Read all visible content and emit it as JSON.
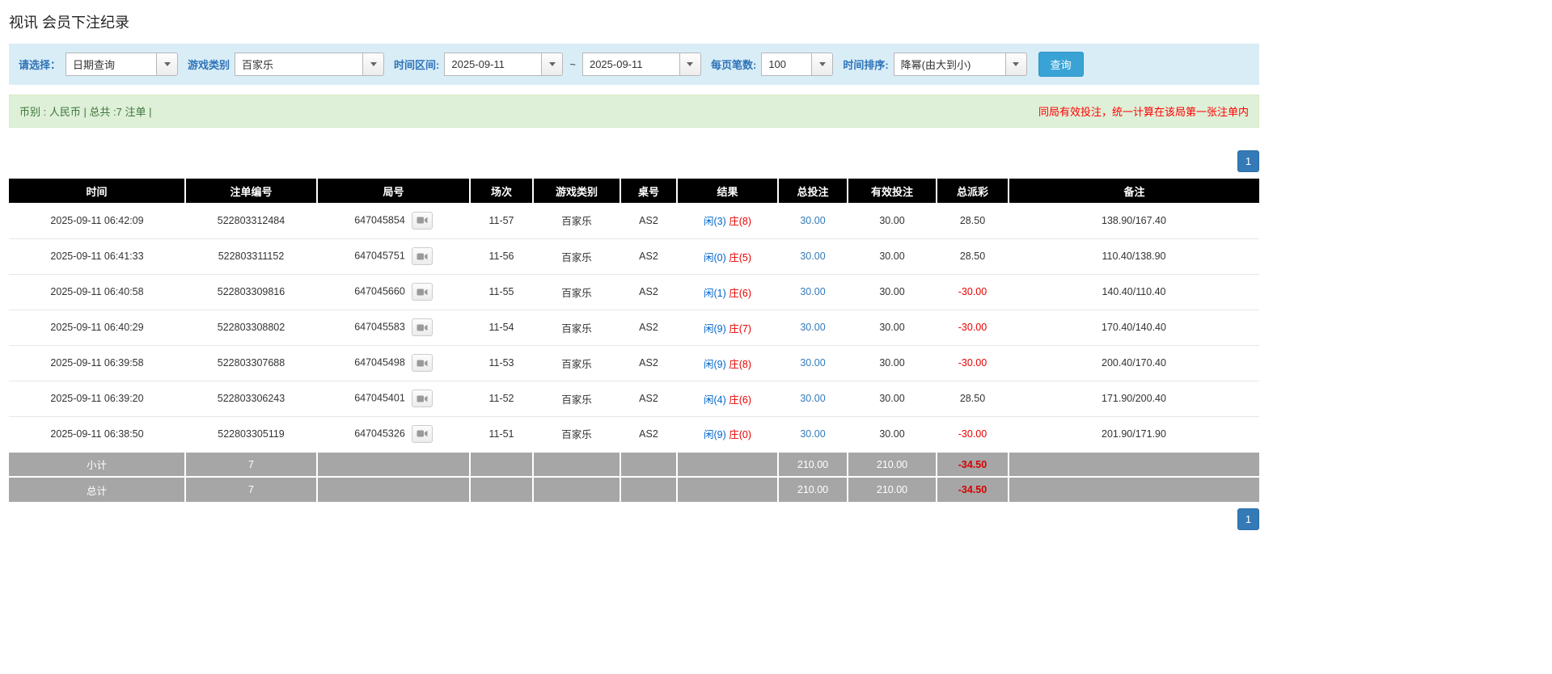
{
  "page": {
    "title": "视讯 会员下注纪录"
  },
  "filters": {
    "select_label": "请选择：",
    "select_value": "日期查询",
    "game_type_label": "游戏类别",
    "game_type_value": "百家乐",
    "time_range_label": "时间区间:",
    "time_from": "2025-09-11",
    "time_separator": "~",
    "time_to": "2025-09-11",
    "page_size_label": "每页笔数:",
    "page_size_value": "100",
    "sort_label": "时间排序:",
    "sort_value": "降幂(由大到小)",
    "search_button": "查询"
  },
  "summary": {
    "left": "币别 : 人民币 | 总共 :7 注单 |",
    "right": "同局有效投注，统一计算在该局第一张注单内"
  },
  "pagination": {
    "page": "1"
  },
  "table": {
    "headers": [
      "时间",
      "注单编号",
      "局号",
      "场次",
      "游戏类别",
      "桌号",
      "结果",
      "总投注",
      "有效投注",
      "总派彩",
      "备注"
    ],
    "rows": [
      {
        "time": "2025-09-11 06:42:09",
        "bet_id": "522803312484",
        "round_id": "647045854",
        "session": "11-57",
        "game": "百家乐",
        "table_no": "AS2",
        "result_player": "闲(3)",
        "result_banker": "庄(8)",
        "total_bet": "30.00",
        "valid_bet": "30.00",
        "payout": "28.50",
        "note": "138.90/167.40"
      },
      {
        "time": "2025-09-11 06:41:33",
        "bet_id": "522803311152",
        "round_id": "647045751",
        "session": "11-56",
        "game": "百家乐",
        "table_no": "AS2",
        "result_player": "闲(0)",
        "result_banker": "庄(5)",
        "total_bet": "30.00",
        "valid_bet": "30.00",
        "payout": "28.50",
        "note": "110.40/138.90"
      },
      {
        "time": "2025-09-11 06:40:58",
        "bet_id": "522803309816",
        "round_id": "647045660",
        "session": "11-55",
        "game": "百家乐",
        "table_no": "AS2",
        "result_player": "闲(1)",
        "result_banker": "庄(6)",
        "total_bet": "30.00",
        "valid_bet": "30.00",
        "payout": "-30.00",
        "note": "140.40/110.40"
      },
      {
        "time": "2025-09-11 06:40:29",
        "bet_id": "522803308802",
        "round_id": "647045583",
        "session": "11-54",
        "game": "百家乐",
        "table_no": "AS2",
        "result_player": "闲(9)",
        "result_banker": "庄(7)",
        "total_bet": "30.00",
        "valid_bet": "30.00",
        "payout": "-30.00",
        "note": "170.40/140.40"
      },
      {
        "time": "2025-09-11 06:39:58",
        "bet_id": "522803307688",
        "round_id": "647045498",
        "session": "11-53",
        "game": "百家乐",
        "table_no": "AS2",
        "result_player": "闲(9)",
        "result_banker": "庄(8)",
        "total_bet": "30.00",
        "valid_bet": "30.00",
        "payout": "-30.00",
        "note": "200.40/170.40"
      },
      {
        "time": "2025-09-11 06:39:20",
        "bet_id": "522803306243",
        "round_id": "647045401",
        "session": "11-52",
        "game": "百家乐",
        "table_no": "AS2",
        "result_player": "闲(4)",
        "result_banker": "庄(6)",
        "total_bet": "30.00",
        "valid_bet": "30.00",
        "payout": "28.50",
        "note": "171.90/200.40"
      },
      {
        "time": "2025-09-11 06:38:50",
        "bet_id": "522803305119",
        "round_id": "647045326",
        "session": "11-51",
        "game": "百家乐",
        "table_no": "AS2",
        "result_player": "闲(9)",
        "result_banker": "庄(0)",
        "total_bet": "30.00",
        "valid_bet": "30.00",
        "payout": "-30.00",
        "note": "201.90/171.90"
      }
    ],
    "subtotal": {
      "label": "小计",
      "count": "7",
      "total_bet": "210.00",
      "valid_bet": "210.00",
      "payout": "-34.50"
    },
    "total": {
      "label": "总计",
      "count": "7",
      "total_bet": "210.00",
      "valid_bet": "210.00",
      "payout": "-34.50"
    }
  },
  "colors": {
    "accent_blue": "#3aa3d6",
    "link_blue": "#337ab7",
    "player_blue": "#0066cc",
    "banker_red": "#e60000",
    "negative_red": "#e60000",
    "filter_bar_bg": "#d9edf7",
    "filter_label_blue": "#2e73b8",
    "summary_bg": "#dff0d8",
    "summary_text_green": "#3c763d",
    "summary_warning_red": "#ff0000",
    "table_header_bg": "#000000",
    "table_footer_bg": "#a6a6a6",
    "pagination_blue": "#337ab7"
  }
}
